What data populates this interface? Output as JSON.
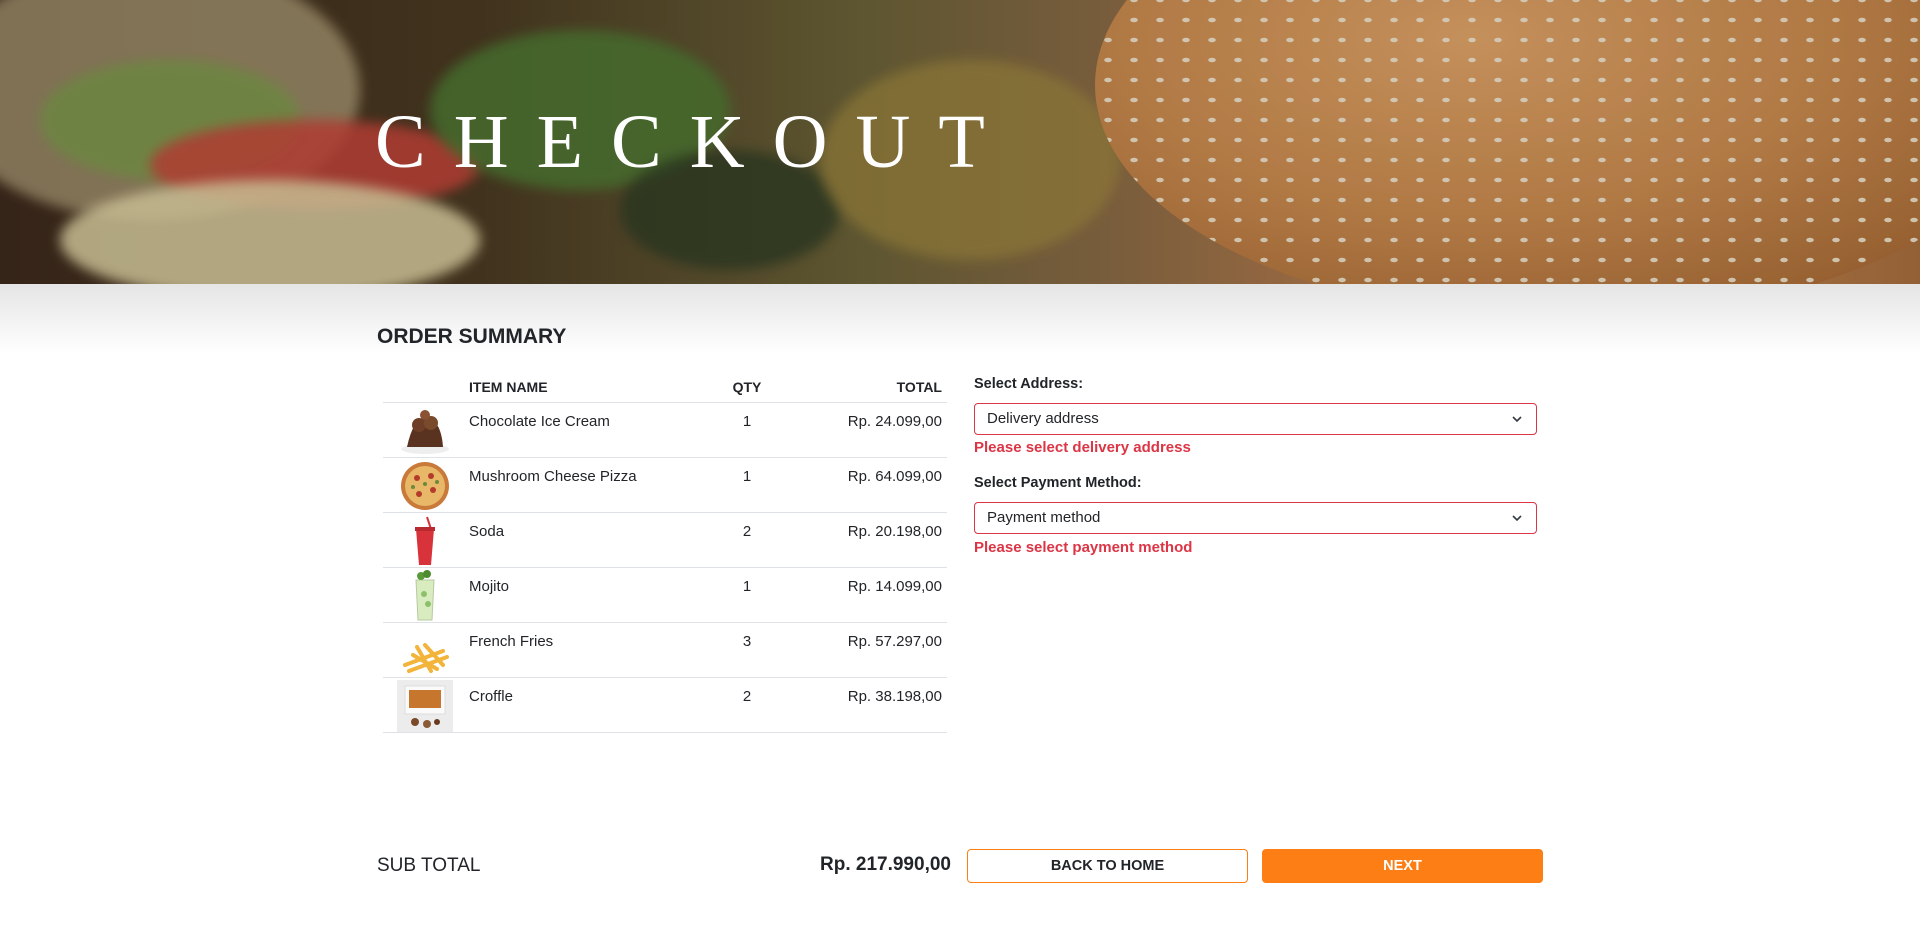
{
  "hero": {
    "title": "CHECKOUT"
  },
  "summary": {
    "title": "ORDER SUMMARY",
    "columns": {
      "item_name": "ITEM NAME",
      "qty": "QTY",
      "total": "TOTAL"
    },
    "items": [
      {
        "name": "Chocolate Ice Cream",
        "qty": "1",
        "total": "Rp. 24.099,00",
        "image": "chocolate-ice-cream-image"
      },
      {
        "name": "Mushroom Cheese Pizza",
        "qty": "1",
        "total": "Rp. 64.099,00",
        "image": "pizza-image"
      },
      {
        "name": "Soda",
        "qty": "2",
        "total": "Rp. 20.198,00",
        "image": "soda-cup-image"
      },
      {
        "name": "Mojito",
        "qty": "1",
        "total": "Rp. 14.099,00",
        "image": "mojito-glass-image"
      },
      {
        "name": "French Fries",
        "qty": "3",
        "total": "Rp. 57.297,00",
        "image": "french-fries-image"
      },
      {
        "name": "Croffle",
        "qty": "2",
        "total": "Rp. 38.198,00",
        "image": "croffle-box-image"
      }
    ]
  },
  "address": {
    "label": "Select Address:",
    "selected": "Delivery address",
    "error": "Please select delivery address"
  },
  "payment": {
    "label": "Select Payment Method:",
    "selected": "Payment method",
    "error": "Please select payment method"
  },
  "footer": {
    "subtotal_label": "SUB TOTAL",
    "subtotal_value": "Rp. 217.990,00",
    "back_label": "BACK TO HOME",
    "next_label": "NEXT"
  },
  "colors": {
    "accent": "#fd7e14",
    "error": "#dc3545",
    "text": "#212529"
  }
}
